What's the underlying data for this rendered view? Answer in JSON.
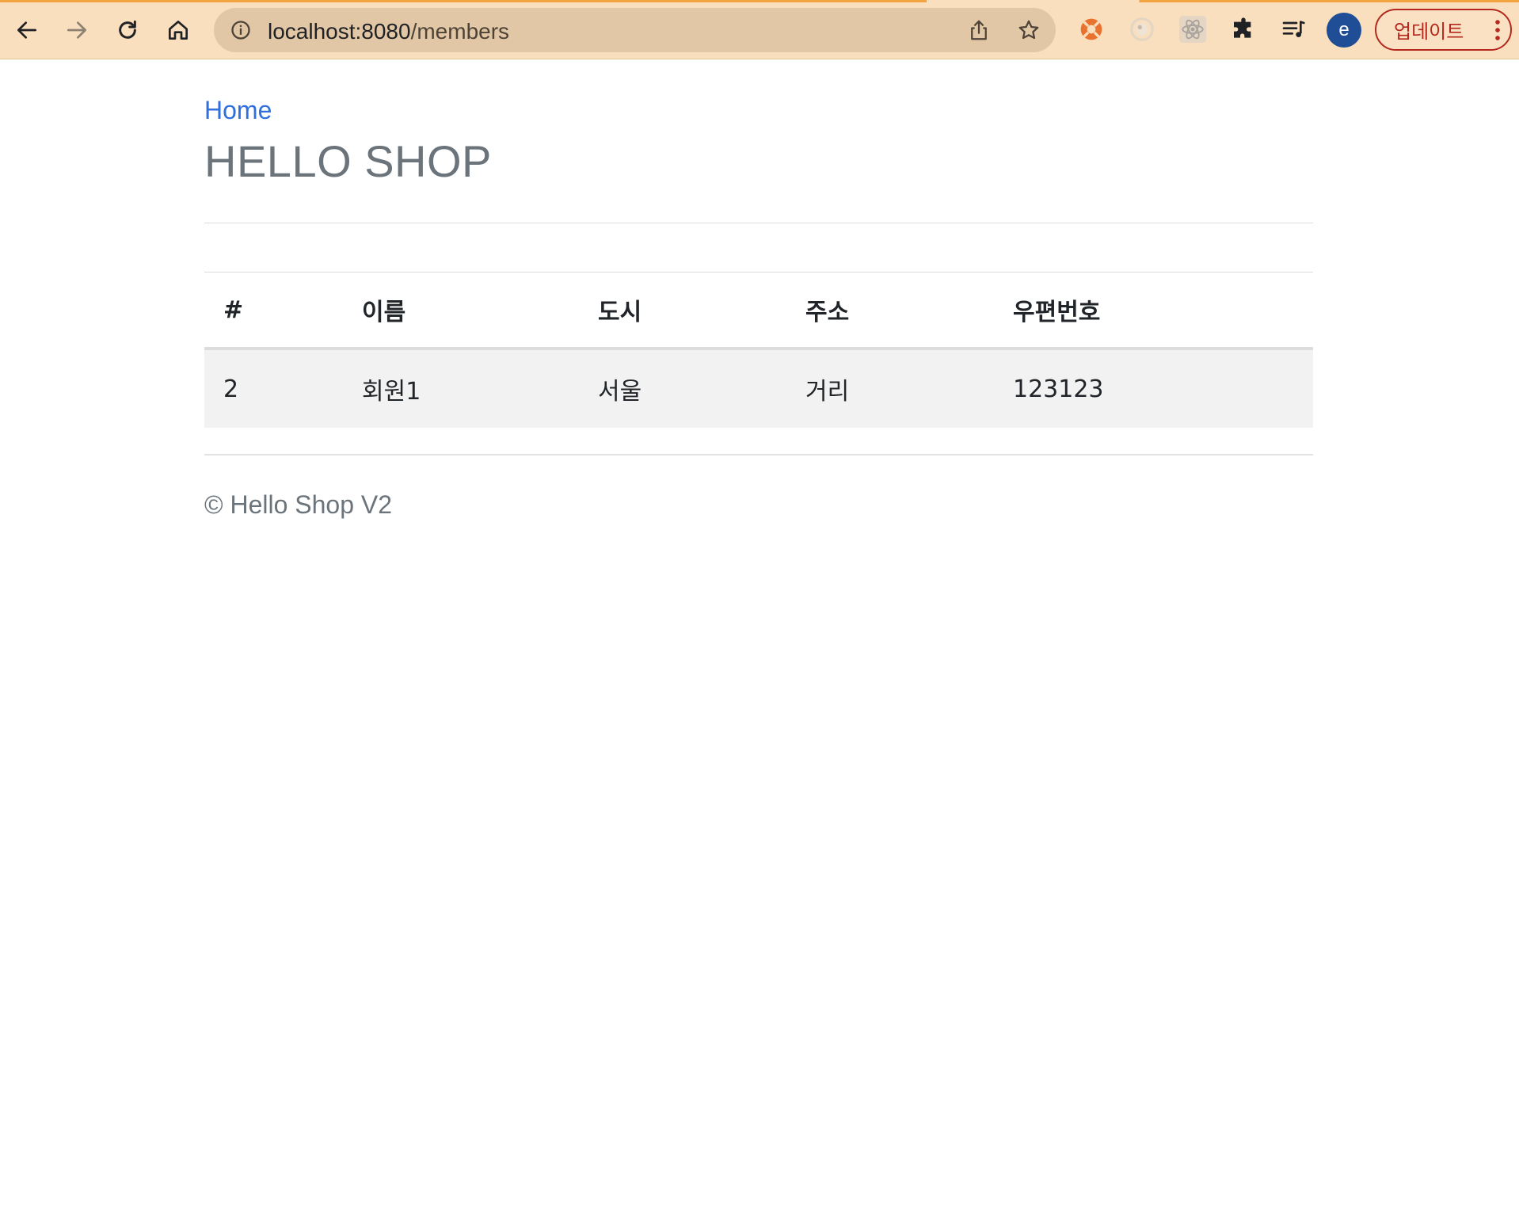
{
  "browser": {
    "url_host": "localhost:8080",
    "url_path": "/members",
    "update_label": "업데이트",
    "avatar_letter": "e"
  },
  "page": {
    "home_link": "Home",
    "title": "HELLO SHOP",
    "footer": "© Hello Shop V2"
  },
  "table": {
    "headers": [
      "#",
      "이름",
      "도시",
      "주소",
      "우편번호"
    ],
    "rows": [
      [
        "2",
        "회원1",
        "서울",
        "거리",
        "123123"
      ]
    ]
  },
  "colors": {
    "chrome": "#f9dfbd",
    "link": "#2f6fde",
    "title": "#6b737b",
    "row_stripe": "#f2f2f2"
  }
}
